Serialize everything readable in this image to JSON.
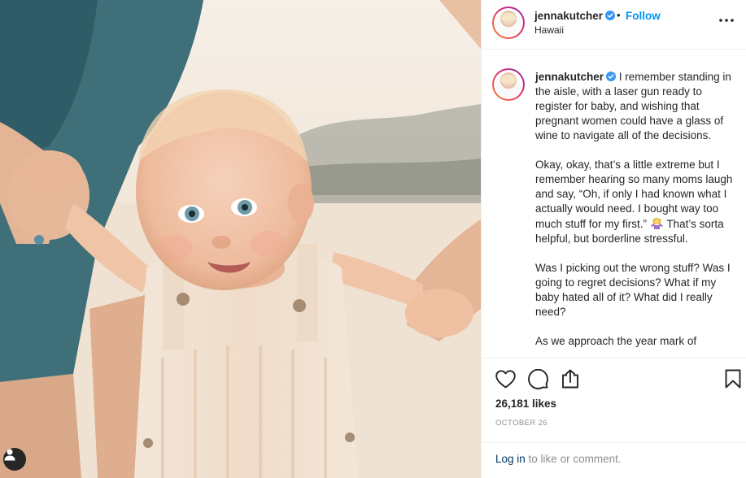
{
  "post": {
    "username": "jennakutcher",
    "follow_label": "Follow",
    "separator": "•",
    "location": "Hawaii"
  },
  "caption": {
    "username": "jennakutcher",
    "paragraphs": [
      "I remember standing in the aisle, with a laser gun ready to register for baby, and wishing that pregnant women could have a glass of wine to navigate all of the decisions.",
      "Okay, okay, that’s a little extreme but I remember hearing so many moms laugh and say, “Oh, if only I had known what I actually would need. I bought way too much stuff for my first.”",
      "That’s sorta helpful, but borderline stressful.",
      "Was I picking out the wrong stuff? Was I going to regret decisions?"
    ],
    "line_what_if": "What if my baby hated all of it?",
    "line_what_did": "What did I really need?",
    "truncated_line": "As we approach the year mark of"
  },
  "actions": {
    "likes": "26,181 likes",
    "date": "OCTOBER 26"
  },
  "login": {
    "link_label": "Log in",
    "rest_label": " to like or comment."
  },
  "icons": {
    "verified": "verified-badge-icon",
    "more": "more-options-icon",
    "like": "heart-icon",
    "comment": "comment-bubble-icon",
    "share": "share-icon",
    "save": "bookmark-icon",
    "user_tag": "user-tag-icon",
    "emoji": "woman-shrugging-emoji-icon"
  },
  "colors": {
    "link_blue": "#0095f6",
    "verified_blue": "#3897f0",
    "text": "#262626",
    "muted": "#8e8e8e"
  }
}
